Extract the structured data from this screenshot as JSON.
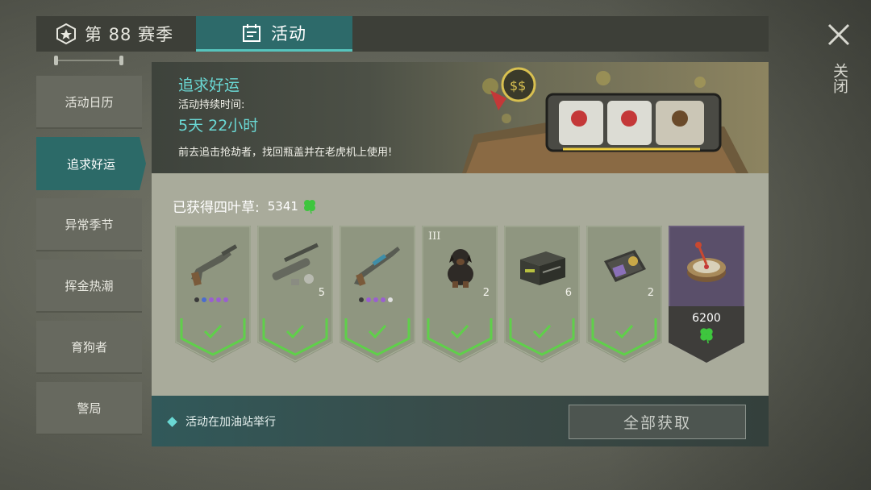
{
  "header": {
    "season_tab": "第 88 赛季",
    "activity_tab": "活动",
    "close_label": "关闭"
  },
  "sidebar": {
    "items": [
      {
        "label": "活动日历",
        "active": false
      },
      {
        "label": "追求好运",
        "active": true
      },
      {
        "label": "异常季节",
        "active": false
      },
      {
        "label": "挥金热潮",
        "active": false
      },
      {
        "label": "育狗者",
        "active": false
      },
      {
        "label": "警局",
        "active": false
      }
    ]
  },
  "banner": {
    "title": "追求好运",
    "duration_label": "活动持续时间:",
    "duration_value": "5天 22小时",
    "description": "前去追击抢劫者，找回瓶盖并在老虎机上使用!"
  },
  "clovers": {
    "label": "已获得四叶草:",
    "value": "5341",
    "icon": "clover-icon"
  },
  "rewards": [
    {
      "icon": "pistol-icon",
      "qty": "",
      "tier": "",
      "claimed": true,
      "rarity_dots": [
        "#3a3a3a",
        "#4a6ccf",
        "#9a5fd0",
        "#9a5fd0",
        "#9a5fd0"
      ]
    },
    {
      "icon": "parts-icon",
      "qty": "5",
      "tier": "",
      "claimed": true,
      "rarity_dots": []
    },
    {
      "icon": "rifle-icon",
      "qty": "",
      "tier": "",
      "claimed": true,
      "rarity_dots": [
        "#3a3a3a",
        "#9a5fd0",
        "#9a5fd0",
        "#9a5fd0",
        "#e0e0e0"
      ]
    },
    {
      "icon": "dog-icon",
      "qty": "2",
      "tier": "III",
      "claimed": true,
      "rarity_dots": []
    },
    {
      "icon": "weapon-crate-icon",
      "qty": "6",
      "tier": "",
      "claimed": true,
      "rarity_dots": []
    },
    {
      "icon": "police-badge-icon",
      "qty": "2",
      "tier": "",
      "claimed": true,
      "rarity_dots": []
    },
    {
      "icon": "roulette-icon",
      "qty": "",
      "tier": "",
      "claimed": false,
      "cost": "6200",
      "cost_icon": "clover-icon"
    }
  ],
  "footer": {
    "location": "活动在加油站举行",
    "collect_all": "全部获取"
  },
  "colors": {
    "accent_teal": "#2c6a68",
    "accent_cyan": "#6ad8d4",
    "claimed_green": "#5fd04a",
    "card_locked": "#5a4f6a"
  }
}
